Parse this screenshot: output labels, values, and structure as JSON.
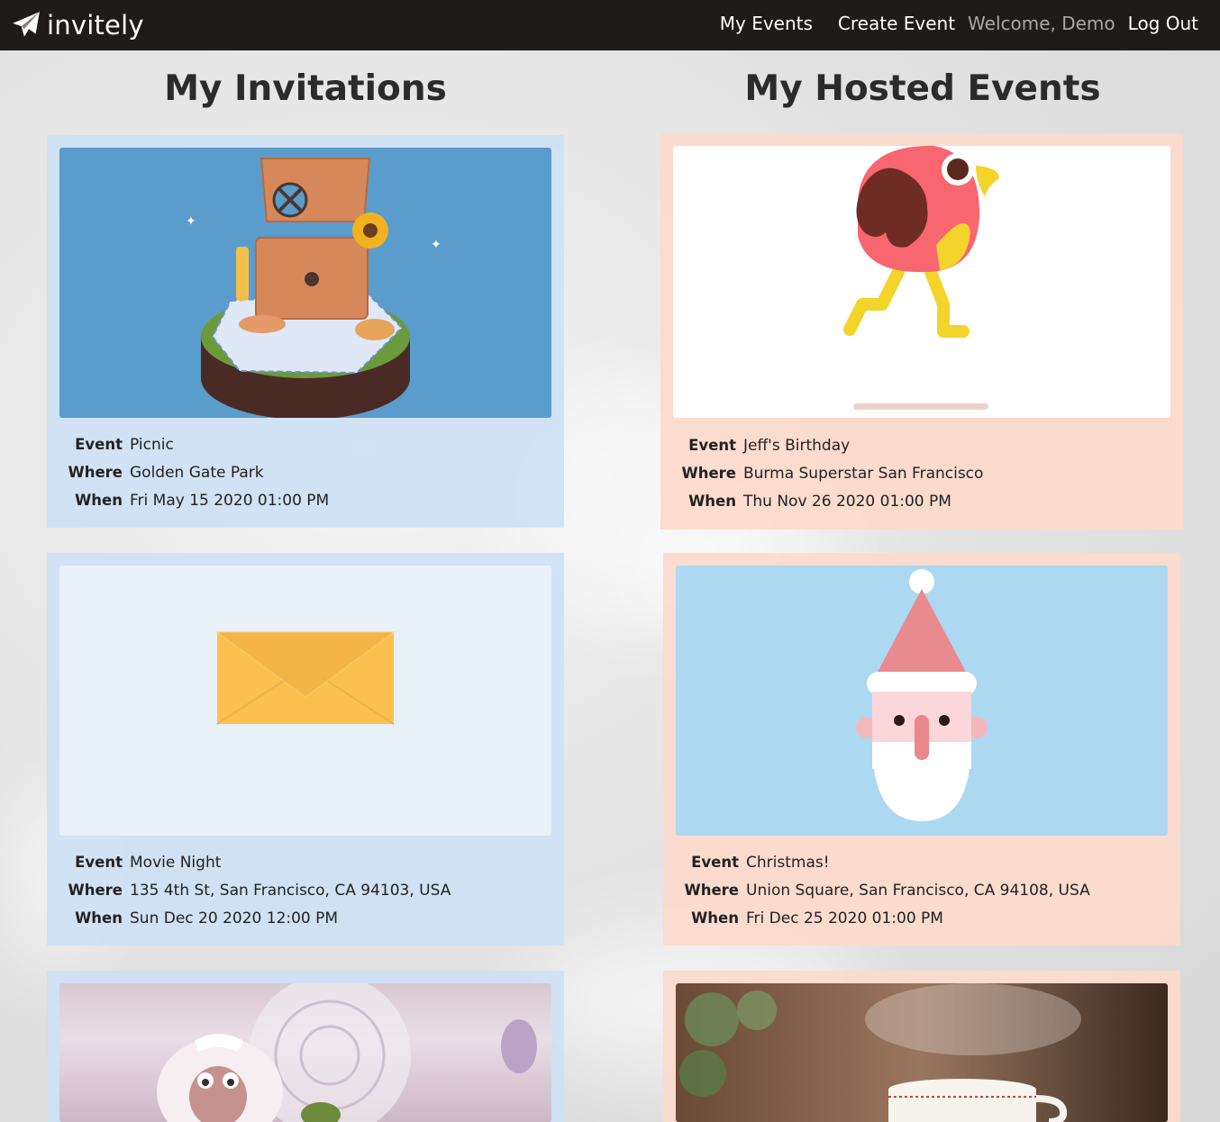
{
  "brand": {
    "name": "invitely"
  },
  "nav": {
    "my_events": "My Events",
    "create_event": "Create Event",
    "welcome": "Welcome, Demo",
    "logout": "Log Out"
  },
  "sections": {
    "invitations_title": "My Invitations",
    "hosted_title": "My Hosted Events"
  },
  "labels": {
    "event": "Event",
    "where": "Where",
    "when": "When"
  },
  "invitations": [
    {
      "event": "Picnic",
      "where": "Golden Gate Park",
      "when": "Fri May 15 2020 01:00 PM",
      "image": "picnic-basket-illustration"
    },
    {
      "event": "Movie Night",
      "where": "135 4th St, San Francisco, CA 94103, USA",
      "when": "Sun Dec 20 2020 12:00 PM",
      "image": "envelope-illustration"
    },
    {
      "event": "",
      "where": "",
      "when": "",
      "image": "muppet-photo"
    }
  ],
  "hosted": [
    {
      "event": "Jeff's Birthday",
      "where": "Burma Superstar San Francisco",
      "when": "Thu Nov 26 2020 01:00 PM",
      "image": "running-bird-illustration"
    },
    {
      "event": "Christmas!",
      "where": "Union Square, San Francisco, CA 94108, USA",
      "when": "Fri Dec 25 2020 01:00 PM",
      "image": "santa-illustration"
    },
    {
      "event": "",
      "where": "",
      "when": "",
      "image": "coffee-cup-photo"
    }
  ],
  "colors": {
    "navbar": "#1e1b1a",
    "invite_card": "#cde1f4",
    "hosted_card": "#fcdacb",
    "picnic_bg": "#5a9ccc",
    "santa_bg": "#acd8f2"
  }
}
